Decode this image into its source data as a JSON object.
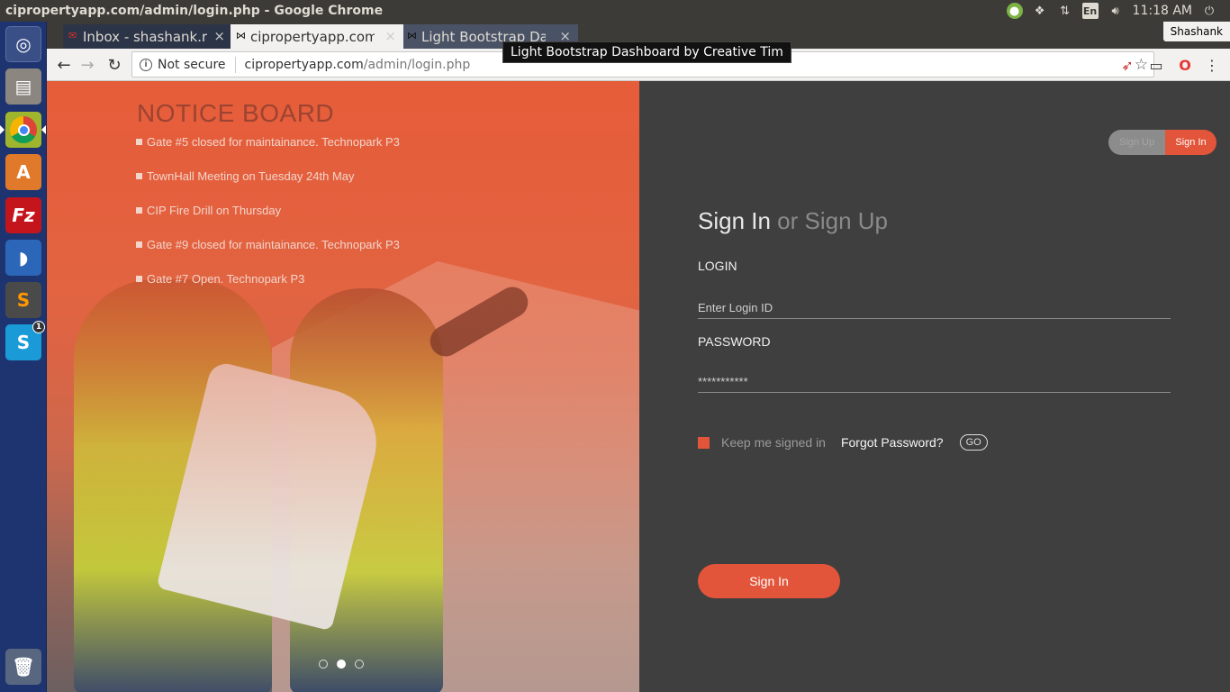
{
  "window": {
    "title": "cipropertyapp.com/admin/login.php - Google Chrome"
  },
  "system_tray": {
    "lang": "En",
    "time": "11:18 AM",
    "user": "Shashank"
  },
  "tabs": [
    {
      "label": "Inbox - shashank.r@",
      "favicon": "gmail-icon"
    },
    {
      "label": "cipropertyapp.com",
      "favicon": "bowtie-icon"
    },
    {
      "label": "Light Bootstrap Da",
      "favicon": "bowtie-icon"
    }
  ],
  "tooltip": "Light Bootstrap Dashboard by Creative Tim",
  "address_bar": {
    "security": "Not secure",
    "host": "cipropertyapp.com",
    "path": "/admin/login.php"
  },
  "notice_board": {
    "title": "NOTICE BOARD",
    "items": [
      "Gate #5 closed for maintainance. Technopark P3",
      "TownHall Meeting on Tuesday 24th May",
      "CIP Fire Drill on Thursday",
      "Gate #9 closed for maintainance. Technopark P3",
      "Gate #7 Open. Technopark P3"
    ]
  },
  "auth": {
    "toggle_signup": "Sign Up",
    "toggle_signin": "Sign In",
    "heading_signin": "Sign In",
    "heading_or": " or Sign Up",
    "login_label": "LOGIN",
    "login_placeholder": "Enter Login ID",
    "password_label": "PASSWORD",
    "password_value": "***********",
    "remember_label": "Keep me signed in",
    "forgot_label": "Forgot Password?",
    "go_label": "GO",
    "submit_label": "Sign In"
  },
  "colors": {
    "accent": "#e2553a",
    "panel_bg": "#3f3f3f"
  }
}
